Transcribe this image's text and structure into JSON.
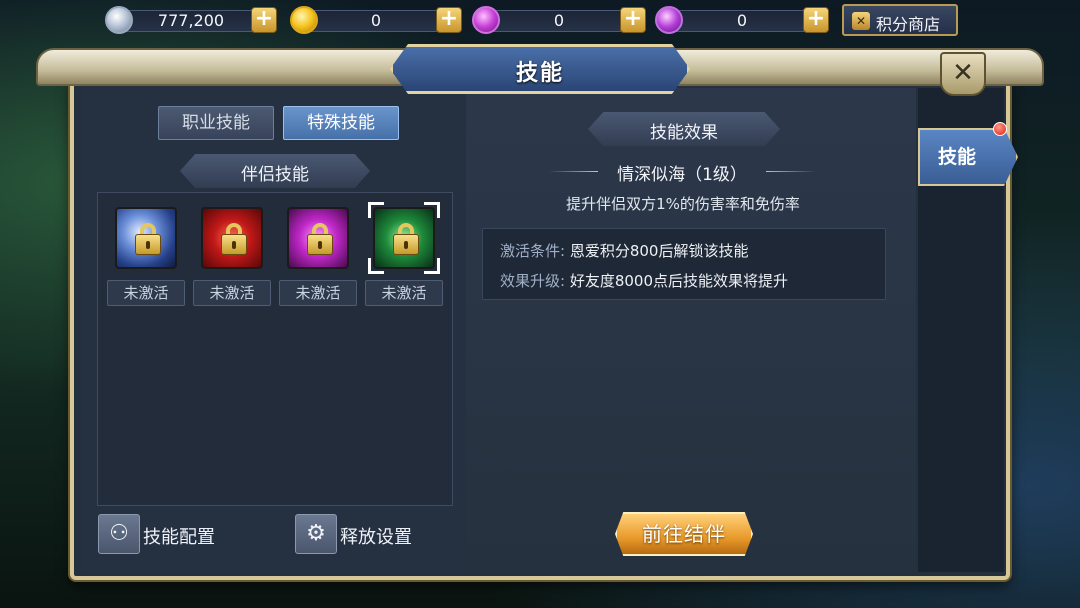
{
  "currencies": [
    {
      "name": "silver",
      "value": "777,200",
      "icon": "silver-coin-icon"
    },
    {
      "name": "gold",
      "value": "0",
      "icon": "gold-coin-icon"
    },
    {
      "name": "bound-gem",
      "value": "0",
      "icon": "locked-gem-icon"
    },
    {
      "name": "gem",
      "value": "0",
      "icon": "gem-icon"
    }
  ],
  "shop_button": {
    "label": "积分商店"
  },
  "window": {
    "title": "技能",
    "close": "✕"
  },
  "tabs": [
    {
      "label": "职业技能",
      "active": false
    },
    {
      "label": "特殊技能",
      "active": true
    }
  ],
  "section_title": "伴侣技能",
  "skills": [
    {
      "status": "未激活"
    },
    {
      "status": "未激活"
    },
    {
      "status": "未激活"
    },
    {
      "status": "未激活",
      "selected": true
    }
  ],
  "bottom_buttons": {
    "config": "技能配置",
    "release": "释放设置"
  },
  "effect": {
    "header": "技能效果",
    "name": "情深似海（1级）",
    "description": "提升伴侣双方1%的伤害率和免伤率",
    "condition_key": "激活条件:",
    "condition_val": "恩爱积分800后解锁该技能",
    "upgrade_key": "效果升级:",
    "upgrade_val": "好友度8000点后技能效果将提升"
  },
  "goto_button": "前往结伴",
  "side_tab": {
    "label": "技能",
    "has_notification": true
  },
  "colors": {
    "frame_gold": "#d7c89a",
    "active_tab": "#4570a8",
    "goto_orange": "#e89a2a",
    "notification": "#e01c10"
  }
}
